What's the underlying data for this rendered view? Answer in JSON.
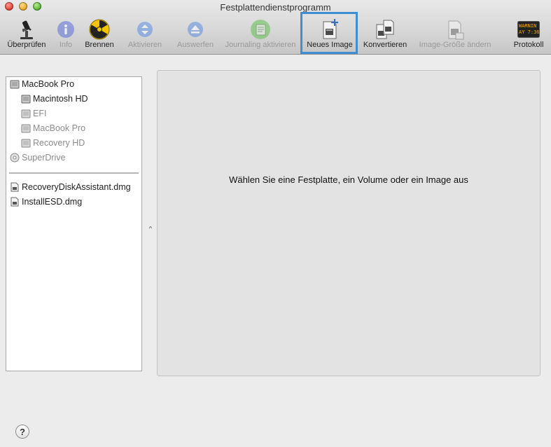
{
  "window": {
    "title": "Festplattendienstprogramm"
  },
  "toolbar": {
    "items": [
      {
        "label": "Überprüfen",
        "icon": "microscope-icon",
        "enabled": true
      },
      {
        "label": "Info",
        "icon": "info-icon",
        "enabled": false
      },
      {
        "label": "Brennen",
        "icon": "burn-icon",
        "enabled": true
      },
      {
        "label": "Aktivieren",
        "icon": "mount-icon",
        "enabled": false
      },
      {
        "label": "Auswerfen",
        "icon": "eject-icon",
        "enabled": false
      },
      {
        "label": "Journaling aktivieren",
        "icon": "journaling-icon",
        "enabled": false
      },
      {
        "label": "Neues Image",
        "icon": "new-image-icon",
        "enabled": true,
        "highlighted": true
      },
      {
        "label": "Konvertieren",
        "icon": "convert-icon",
        "enabled": true
      },
      {
        "label": "Image-Größe ändern",
        "icon": "resize-image-icon",
        "enabled": false
      },
      {
        "label": "Protokoll",
        "icon": "log-console-icon",
        "enabled": true,
        "icon_text": "WARNIN\nAY 7:36"
      }
    ]
  },
  "sidebar": {
    "devices": [
      {
        "label": "MacBook Pro",
        "level": 0,
        "dim": false,
        "icon": "disk-icon"
      },
      {
        "label": "Macintosh HD",
        "level": 1,
        "dim": false,
        "icon": "volume-icon"
      },
      {
        "label": "EFI",
        "level": 1,
        "dim": true,
        "icon": "volume-icon"
      },
      {
        "label": "MacBook Pro",
        "level": 1,
        "dim": true,
        "icon": "volume-icon"
      },
      {
        "label": "Recovery HD",
        "level": 1,
        "dim": true,
        "icon": "volume-icon"
      },
      {
        "label": "SuperDrive",
        "level": 0,
        "dim": true,
        "icon": "optical-drive-icon"
      }
    ],
    "images": [
      {
        "label": "RecoveryDiskAssistant.dmg",
        "icon": "dmg-file-icon"
      },
      {
        "label": "InstallESD.dmg",
        "icon": "dmg-file-icon"
      }
    ]
  },
  "main": {
    "message": "Wählen Sie eine Festplatte, ein Volume oder ein Image aus"
  },
  "help": {
    "label": "?"
  },
  "colors": {
    "highlight": "#3f8fd0",
    "toolbar_bg": "#d6d6d6",
    "panel_bg": "#e3e3e3"
  }
}
